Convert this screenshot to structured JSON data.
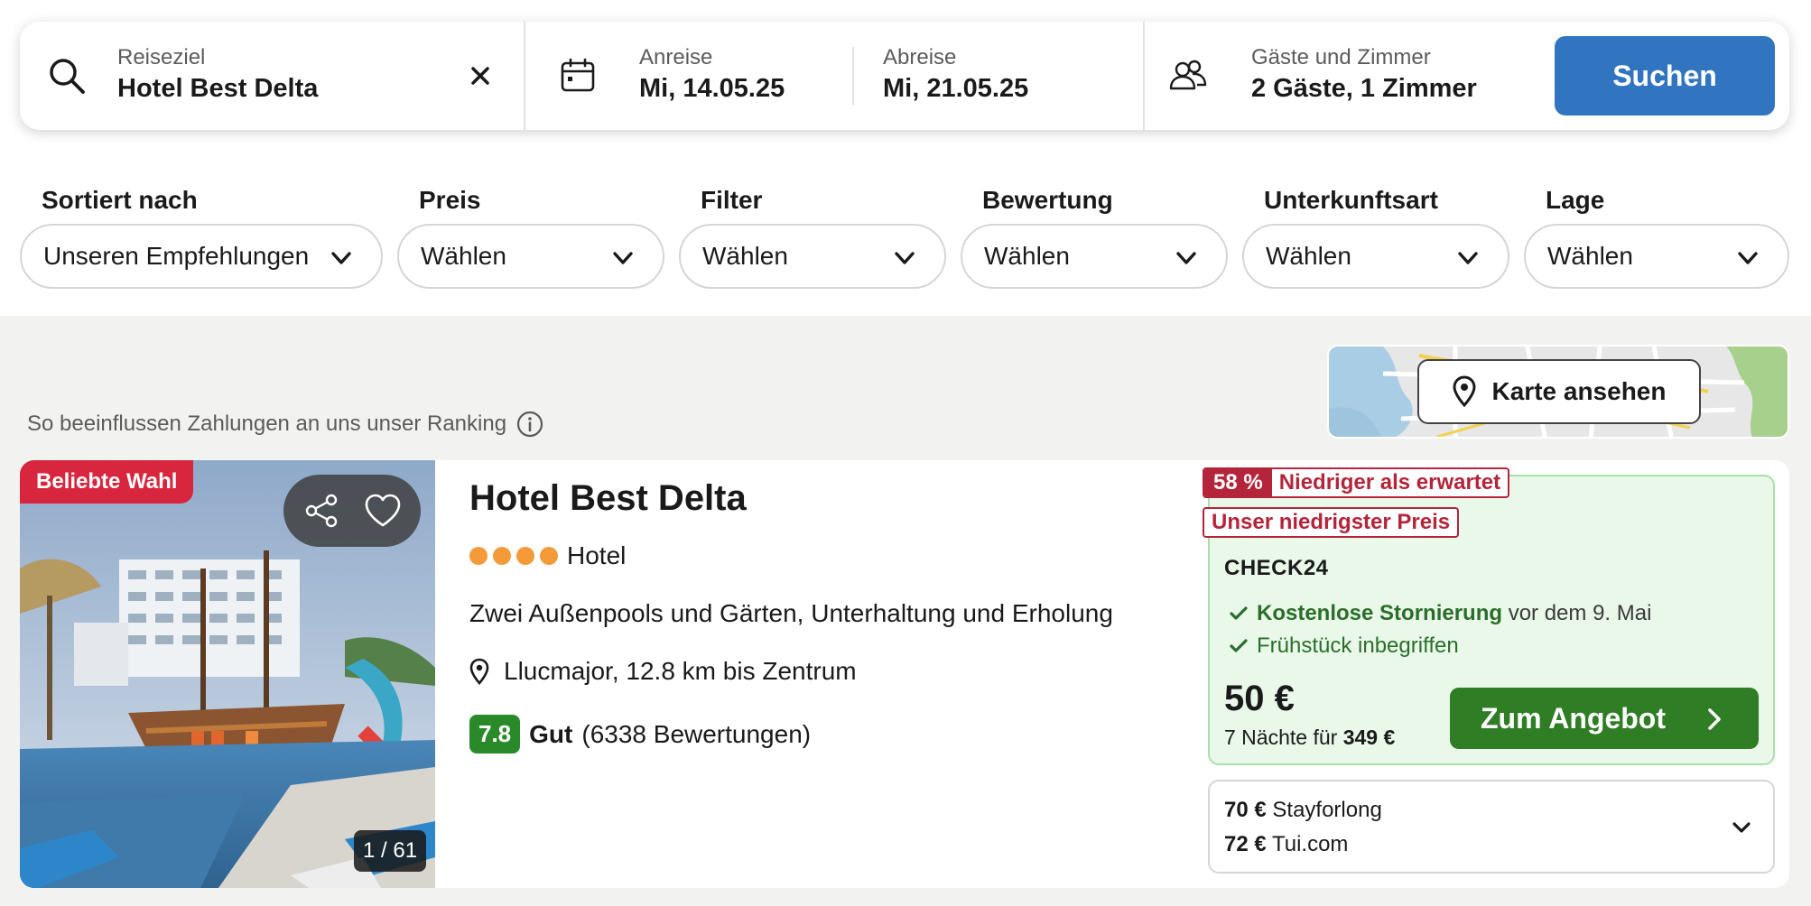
{
  "search": {
    "destination_label": "Reiseziel",
    "destination_value": "Hotel Best Delta",
    "checkin_label": "Anreise",
    "checkin_value": "Mi, 14.05.25",
    "checkout_label": "Abreise",
    "checkout_value": "Mi, 21.05.25",
    "guests_label": "Gäste und Zimmer",
    "guests_value": "2 Gäste, 1 Zimmer",
    "search_button": "Suchen"
  },
  "filters": [
    {
      "label": "Sortiert nach",
      "value": "Unseren Empfehlungen"
    },
    {
      "label": "Preis",
      "value": "Wählen"
    },
    {
      "label": "Filter",
      "value": "Wählen"
    },
    {
      "label": "Bewertung",
      "value": "Wählen"
    },
    {
      "label": "Unterkunftsart",
      "value": "Wählen"
    },
    {
      "label": "Lage",
      "value": "Wählen"
    }
  ],
  "ranking_note": "So beeinflussen Zahlungen an uns unser Ranking",
  "map_button": "Karte ansehen",
  "hotel": {
    "badge": "Beliebte Wahl",
    "photo_counter": "1 / 61",
    "name": "Hotel Best Delta",
    "star_count": 4,
    "type": "Hotel",
    "description": "Zwei Außenpools und Gärten, Unterhaltung und Erholung",
    "location": "Llucmajor, 12.8 km bis Zentrum",
    "rating_score": "7.8",
    "rating_word": "Gut",
    "rating_count": "(6338 Bewertungen)"
  },
  "offer": {
    "discount_pct": "58 %",
    "discount_text": "Niedriger als erwartet",
    "lowest_price_tag": "Unser niedrigster Preis",
    "provider": "CHECK24",
    "perk1_bold": "Kostenlose Stornierung",
    "perk1_rest": "vor dem 9. Mai",
    "perk2": "Frühstück inbegriffen",
    "price": "50 €",
    "nights_prefix": "7 Nächte für",
    "nights_total": "349 €",
    "cta": "Zum Angebot"
  },
  "other_offers": [
    {
      "price": "70 €",
      "provider": "Stayforlong"
    },
    {
      "price": "72 €",
      "provider": "Tui.com"
    }
  ],
  "colors": {
    "search_button": "#3175c0",
    "popular_badge": "#d7263d",
    "deal_red": "#b4243a",
    "offer_bg": "#e9f8e9",
    "cta_green": "#2f7d24",
    "score_green": "#2a8a2a",
    "star": "#f59a38"
  }
}
